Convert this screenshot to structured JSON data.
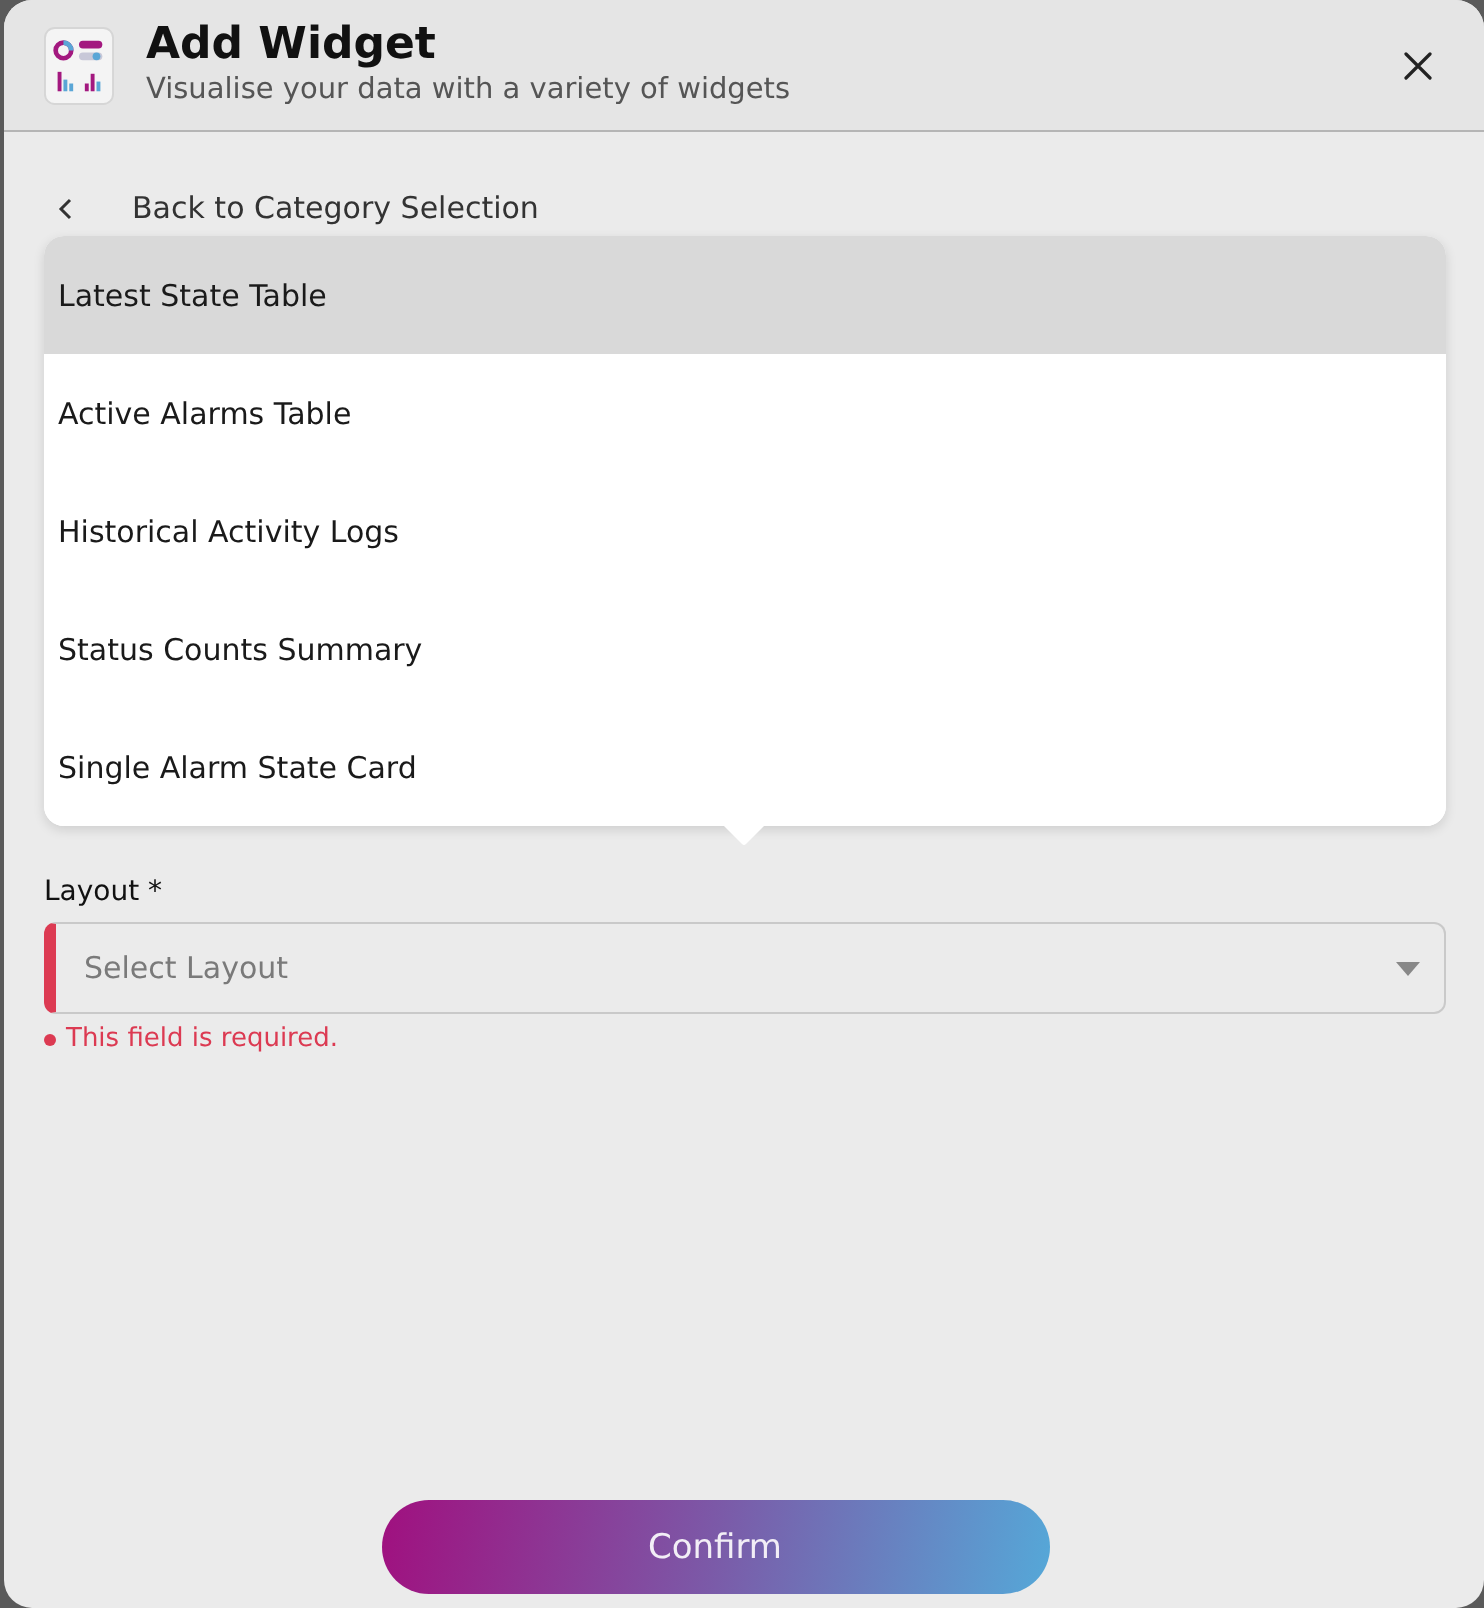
{
  "dialog": {
    "title": "Add Widget",
    "subtitle": "Visualise your data with a variety of widgets"
  },
  "back_link": {
    "label": "Back to Category Selection"
  },
  "widget_menu": {
    "items": [
      {
        "label": "Latest State Table",
        "selected": true
      },
      {
        "label": "Active Alarms Table",
        "selected": false
      },
      {
        "label": "Historical Activity Logs",
        "selected": false
      },
      {
        "label": "Status Counts Summary",
        "selected": false
      },
      {
        "label": "Single Alarm State Card",
        "selected": false
      }
    ]
  },
  "layout_field": {
    "label": "Layout *",
    "placeholder": "Select Layout",
    "invalid": true,
    "error": "This field is required."
  },
  "buttons": [
    {
      "label": "Confirm"
    }
  ]
}
